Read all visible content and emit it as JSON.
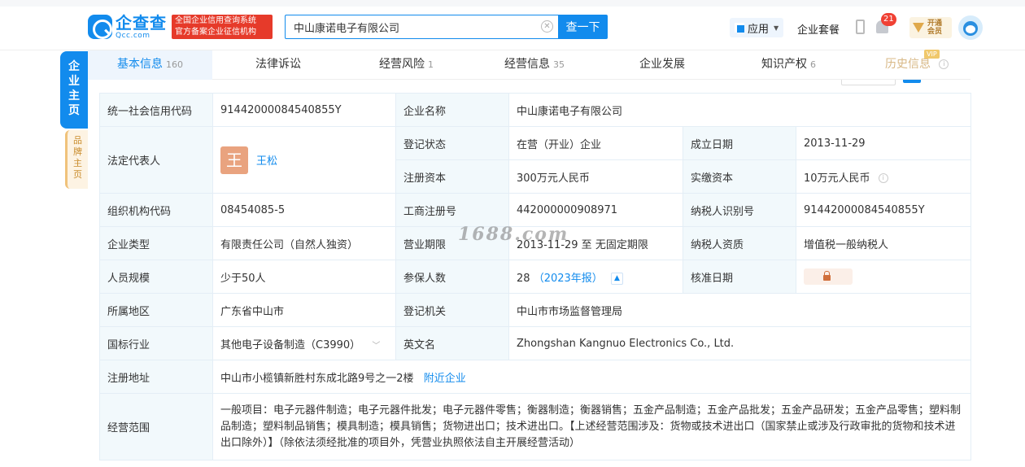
{
  "header": {
    "logo_cn": "企查查",
    "logo_en": "Qcc.com",
    "badge_line1": "全国企业信用查询系统",
    "badge_line2": "官方备案企业征信机构",
    "search_value": "中山康诺电子有限公司",
    "search_button": "查一下",
    "app_label": "应用",
    "package_label": "企业套餐",
    "notification_count": "21",
    "vip_open_label": "开通会员",
    "accent_color": "#128bed"
  },
  "side_tabs": {
    "main": "企业主页",
    "brand": "品牌主页"
  },
  "tabs": [
    {
      "label": "基本信息",
      "count": "160"
    },
    {
      "label": "法律诉讼",
      "count": ""
    },
    {
      "label": "经营风险",
      "count": "1"
    },
    {
      "label": "经营信息",
      "count": "35"
    },
    {
      "label": "企业发展",
      "count": ""
    },
    {
      "label": "知识产权",
      "count": "6"
    },
    {
      "label": "历史信息",
      "count": "",
      "tag": "VIP"
    }
  ],
  "info": {
    "credit_code_label": "统一社会信用代码",
    "credit_code": "91442000084540855Y",
    "company_name_label": "企业名称",
    "company_name": "中山康诺电子有限公司",
    "legal_rep_label": "法定代表人",
    "legal_rep_avatar": "王",
    "legal_rep": "王松",
    "reg_status_label": "登记状态",
    "reg_status": "在营（开业）企业",
    "est_date_label": "成立日期",
    "est_date": "2013-11-29",
    "reg_capital_label": "注册资本",
    "reg_capital": "300万元人民币",
    "paid_capital_label": "实缴资本",
    "paid_capital": "10万元人民币",
    "org_code_label": "组织机构代码",
    "org_code": "08454085-5",
    "biz_reg_no_label": "工商注册号",
    "biz_reg_no": "442000000908971",
    "taxpayer_id_label": "纳税人识别号",
    "taxpayer_id": "91442000084540855Y",
    "company_type_label": "企业类型",
    "company_type": "有限责任公司（自然人独资）",
    "biz_term_label": "营业期限",
    "biz_term": "2013-11-29 至 无固定期限",
    "taxpayer_qual_label": "纳税人资质",
    "taxpayer_qual": "增值税一般纳税人",
    "staff_size_label": "人员规模",
    "staff_size": "少于50人",
    "insured_label": "参保人数",
    "insured": "28",
    "insured_year": "（2023年报）",
    "approval_date_label": "核准日期",
    "region_label": "所属地区",
    "region": "广东省中山市",
    "reg_authority_label": "登记机关",
    "reg_authority": "中山市市场监督管理局",
    "industry_label": "国标行业",
    "industry": "其他电子设备制造（C3990）",
    "english_name_label": "英文名",
    "english_name": "Zhongshan Kangnuo Electronics Co., Ltd.",
    "address_label": "注册地址",
    "address": "中山市小榄镇新胜村东成北路9号之一2楼",
    "nearby_link": "附近企业",
    "scope_label": "经营范围",
    "scope": "一般项目：电子元器件制造；电子元器件批发；电子元器件零售；衡器制造；衡器销售；五金产品制造；五金产品批发；五金产品研发；五金产品零售；塑料制品制造；塑料制品销售；模具制造；模具销售；货物进出口；技术进出口。【上述经营范围涉及：货物或技术进出口（国家禁止或涉及行政审批的货物和技术进出口除外）】（除依法须经批准的项目外，凭营业执照依法自主开展经营活动）"
  },
  "watermark": "1688.com"
}
